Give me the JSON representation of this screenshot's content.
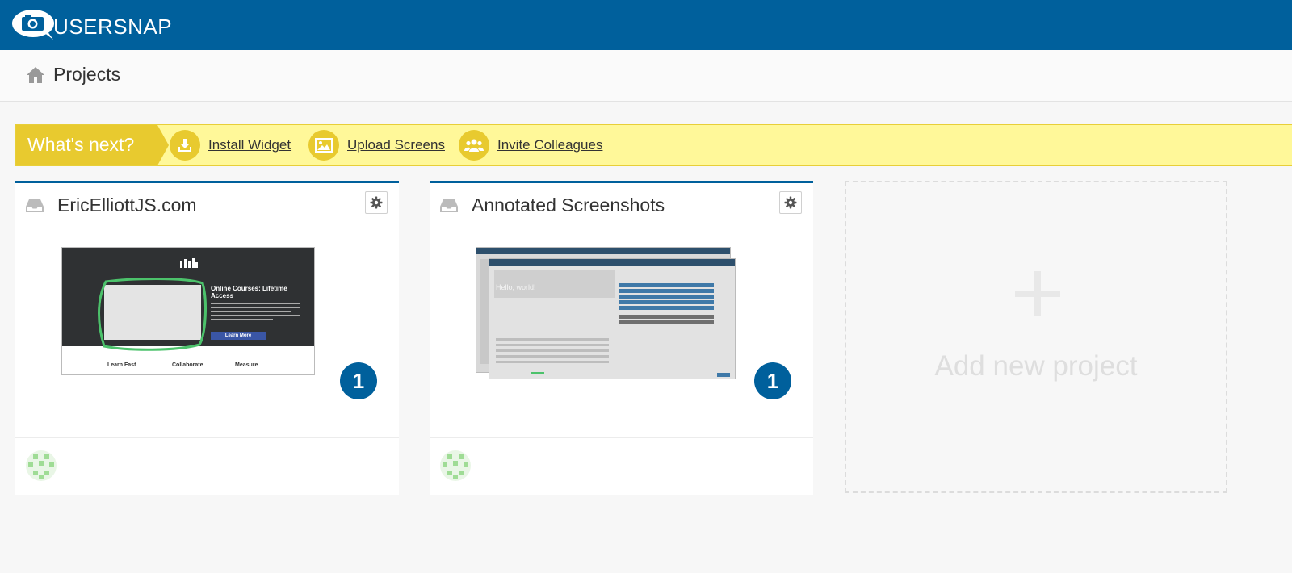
{
  "app": {
    "brand": "USERSNAP",
    "brand_color": "#00609c"
  },
  "header": {
    "page_title": "Projects"
  },
  "whats_next": {
    "label": "What's next?",
    "items": [
      {
        "label": "Install Widget",
        "icon": "download-icon"
      },
      {
        "label": "Upload Screens",
        "icon": "image-icon"
      },
      {
        "label": "Invite Colleagues",
        "icon": "users-icon"
      }
    ],
    "accent_color": "#e8ca2f",
    "background_color": "#fff899"
  },
  "projects": [
    {
      "title": "EricElliottJS.com",
      "count": "1",
      "preview": {
        "headline": "Online Courses: Lifetime Access",
        "button": "Learn More",
        "features": [
          "Learn Fast",
          "Collaborate",
          "Measure"
        ]
      }
    },
    {
      "title": "Annotated Screenshots",
      "count": "1",
      "preview": {
        "greeting": "Hello, world!"
      }
    }
  ],
  "add_project": {
    "label": "Add new project"
  }
}
